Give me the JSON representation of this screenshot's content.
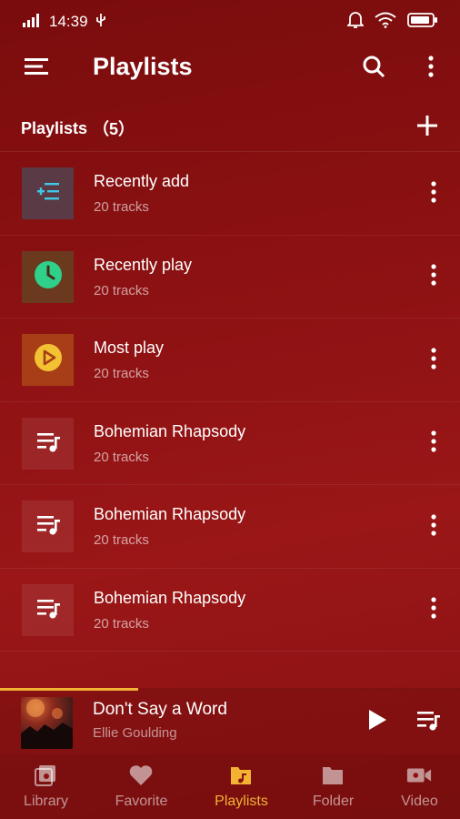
{
  "status_bar": {
    "time": "14:39",
    "icons": [
      "signal-icon",
      "usb-icon",
      "bell-icon",
      "wifi-icon",
      "battery-icon"
    ]
  },
  "app_bar": {
    "title": "Playlists",
    "icons": [
      "menu-icon",
      "search-icon",
      "more-vertical-icon"
    ]
  },
  "section": {
    "title": "Playlists",
    "count": "（5）"
  },
  "playlists": [
    {
      "title": "Recently add",
      "subtitle": "20 tracks",
      "icon": "playlist-add-icon"
    },
    {
      "title": "Recently play",
      "subtitle": "20 tracks",
      "icon": "clock-icon"
    },
    {
      "title": "Most play",
      "subtitle": "20 tracks",
      "icon": "play-circle-icon"
    },
    {
      "title": "Bohemian Rhapsody",
      "subtitle": "20 tracks",
      "icon": "playlist-icon"
    },
    {
      "title": "Bohemian Rhapsody",
      "subtitle": "20 tracks",
      "icon": "playlist-icon"
    },
    {
      "title": "Bohemian Rhapsody",
      "subtitle": "20 tracks",
      "icon": "playlist-icon"
    }
  ],
  "now_playing": {
    "title": "Don't Say a Word",
    "artist": "Ellie Goulding",
    "progress": 0.3
  },
  "bottom_nav": [
    {
      "label": "Library",
      "icon": "library-icon",
      "active": false
    },
    {
      "label": "Favorite",
      "icon": "heart-icon",
      "active": false
    },
    {
      "label": "Playlists",
      "icon": "playlists-icon",
      "active": true
    },
    {
      "label": "Folder",
      "icon": "folder-icon",
      "active": false
    },
    {
      "label": "Video",
      "icon": "video-icon",
      "active": false
    }
  ],
  "colors": {
    "accent": "#f2b233",
    "background": "#8c1112",
    "recent_add_icon": "#3fc8e8",
    "recent_play_icon": "#2fd08a",
    "most_play_icon": "#f2c233"
  }
}
